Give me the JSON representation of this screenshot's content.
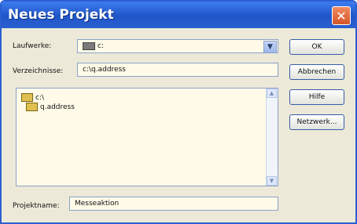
{
  "window": {
    "title": "Neues Projekt",
    "close_glyph": "✕"
  },
  "drive": {
    "label": "Laufwerke:",
    "value": "c:"
  },
  "directory": {
    "label": "Verzeichnisse:",
    "value": "c:\\q.address"
  },
  "tree": {
    "items": [
      "c:\\",
      "q.address"
    ]
  },
  "project": {
    "label": "Projektname:",
    "value": "Messeaktion"
  },
  "buttons": {
    "ok": "OK",
    "cancel": "Abbrechen",
    "help": "Hilfe",
    "network": "Netzwerk..."
  },
  "icons": {
    "drive": "drive-icon",
    "folder": "folder-icon",
    "dropdown": "chevron-down-icon",
    "close": "close-icon"
  }
}
